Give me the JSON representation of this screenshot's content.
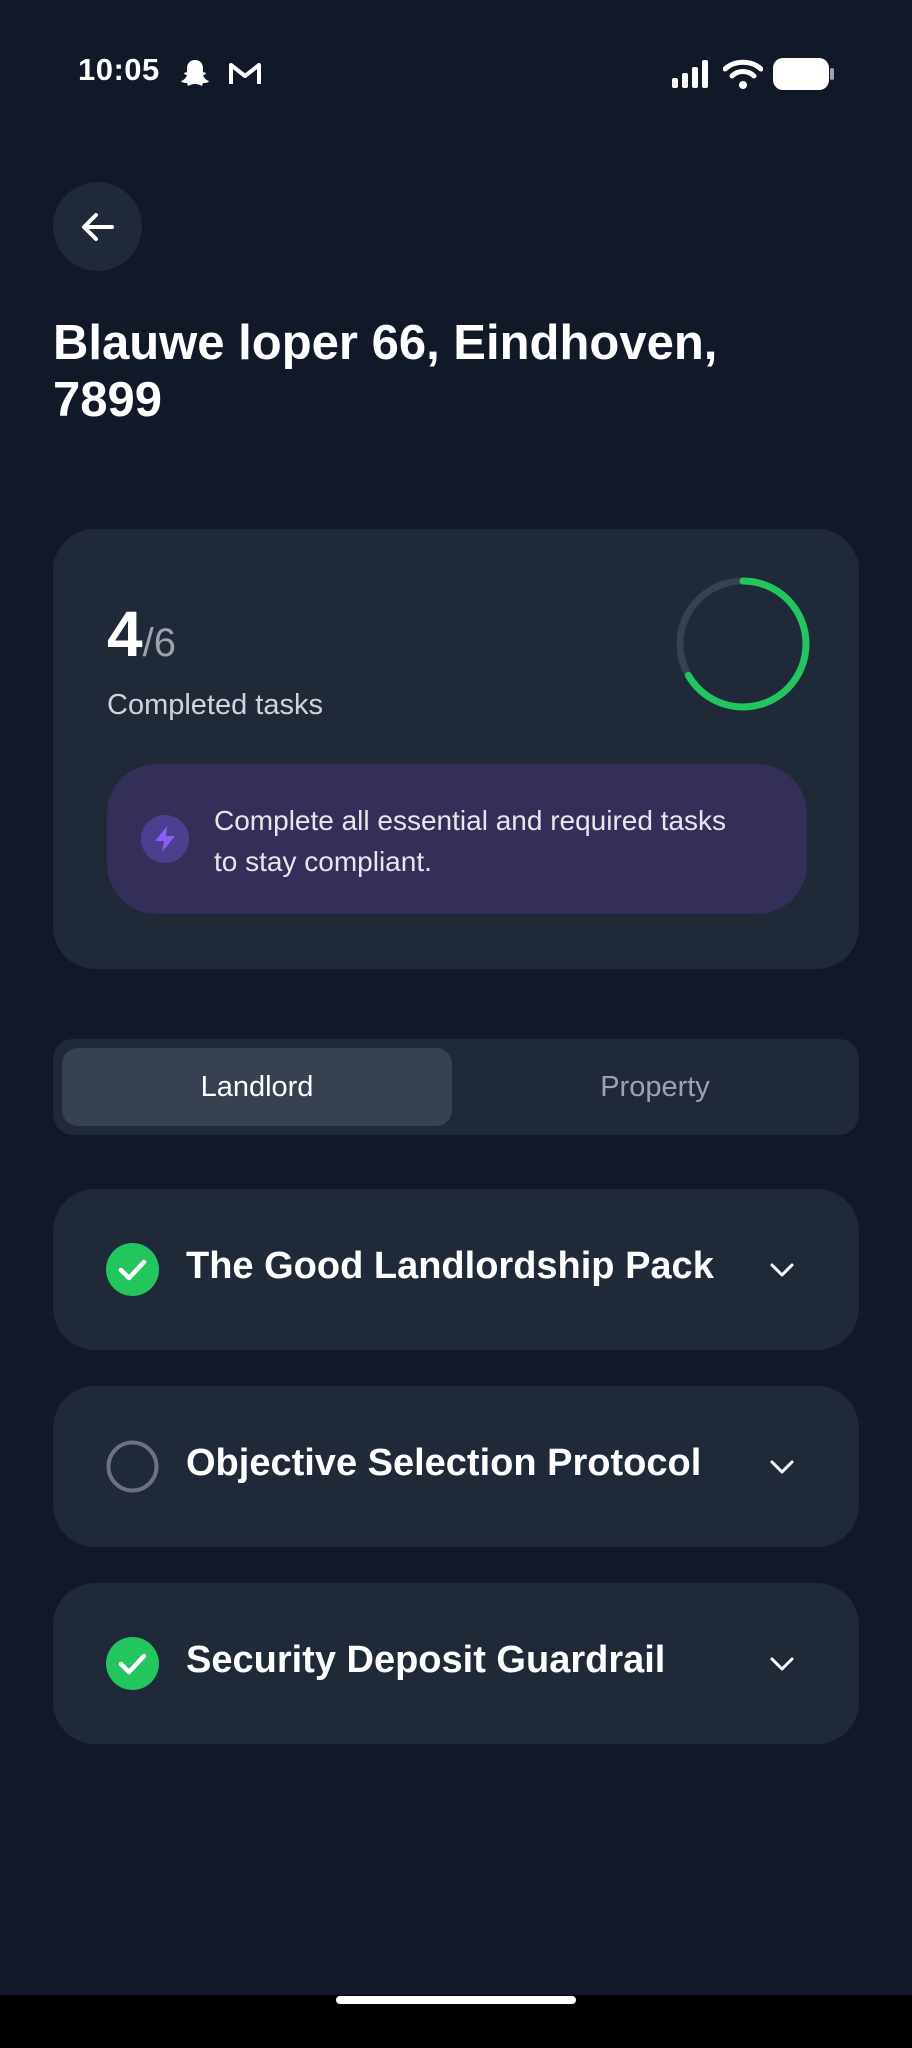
{
  "status_bar": {
    "time": "10:05",
    "icons": [
      "snapchat-icon",
      "gmail-icon",
      "signal-icon",
      "wifi-icon",
      "battery-icon"
    ]
  },
  "header": {
    "back_icon": "arrow-left-icon",
    "title": "Blauwe loper 66, Eindhoven, 7899"
  },
  "progress": {
    "completed": "4",
    "separator": "/",
    "total": "6",
    "label": "Completed tasks",
    "fraction": 0.6667,
    "ring_color": "#22c55e",
    "notice": {
      "icon": "lightning-icon",
      "text": "Complete all essential and required tasks to stay compliant."
    }
  },
  "tabs": [
    {
      "label": "Landlord",
      "active": true
    },
    {
      "label": "Property",
      "active": false
    }
  ],
  "tasks": [
    {
      "title": "The Good Landlordship Pack",
      "completed": true
    },
    {
      "title": "Objective Selection Protocol",
      "completed": false
    },
    {
      "title": "Security Deposit Guardrail",
      "completed": true
    }
  ],
  "colors": {
    "background": "#111827",
    "card": "#1f2937",
    "success": "#22c55e",
    "notice_bg": "#332f59",
    "accent_purple": "#8b5cf6"
  }
}
